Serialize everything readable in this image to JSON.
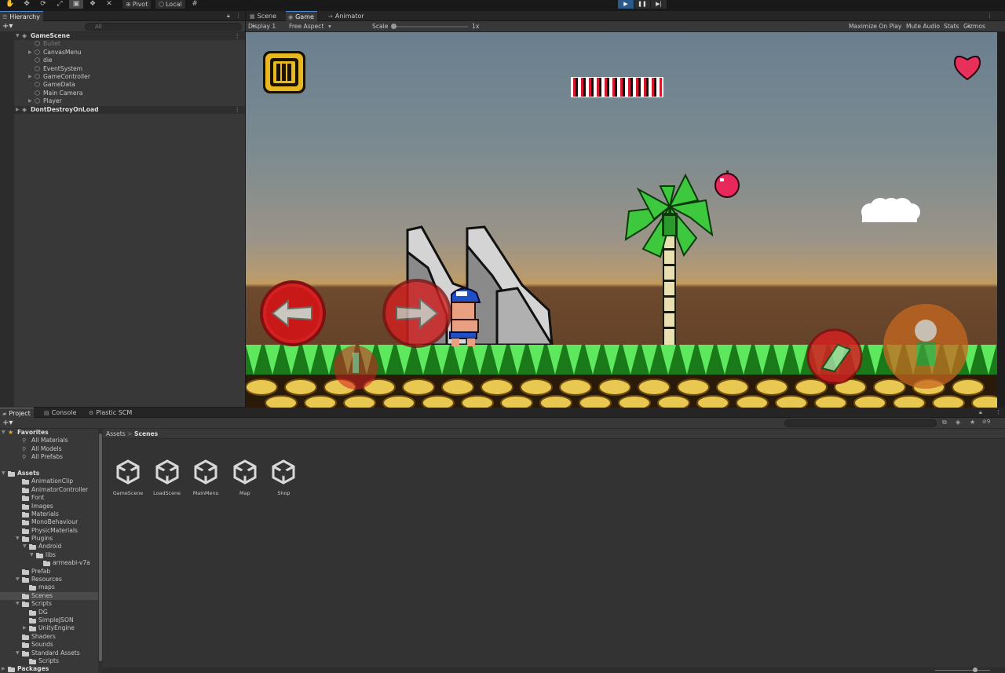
{
  "toolbar": {
    "pivot_label": "Pivot",
    "local_label": "Local"
  },
  "hierarchy": {
    "tab_label": "Hierarchy",
    "search_placeholder": "All",
    "items": [
      {
        "label": "GameScene",
        "type": "scene"
      },
      {
        "label": "Bullet",
        "type": "disabled"
      },
      {
        "label": "CanvasMenu"
      },
      {
        "label": "die"
      },
      {
        "label": "EventSystem"
      },
      {
        "label": "GameController"
      },
      {
        "label": "GameData"
      },
      {
        "label": "Main Camera"
      },
      {
        "label": "Player"
      },
      {
        "label": "DontDestroyOnLoad",
        "type": "scene"
      }
    ]
  },
  "game_tabs": {
    "scene": "Scene",
    "game": "Game",
    "animator": "Animator"
  },
  "game_bar": {
    "display": "Display 1",
    "aspect": "Free Aspect",
    "scale_label": "Scale",
    "scale_value": "1x",
    "maximize": "Maximize On Play",
    "mute": "Mute Audio",
    "stats": "Stats",
    "gizmos": "Gizmos"
  },
  "project_tabs": {
    "project": "Project",
    "console": "Console",
    "plastic": "Plastic SCM"
  },
  "project": {
    "badge_count": "9",
    "breadcrumb_root": "Assets",
    "breadcrumb_sep": ">",
    "breadcrumb_current": "Scenes",
    "tree": [
      {
        "label": "Favorites",
        "kind": "favorites"
      },
      {
        "label": "All Materials",
        "kind": "search"
      },
      {
        "label": "All Models",
        "kind": "search"
      },
      {
        "label": "All Prefabs",
        "kind": "search"
      },
      {
        "label": "",
        "kind": "spacer"
      },
      {
        "label": "Assets",
        "kind": "header"
      },
      {
        "label": "AnimationClip"
      },
      {
        "label": "AnimatorController"
      },
      {
        "label": "Font"
      },
      {
        "label": "Images"
      },
      {
        "label": "Materials"
      },
      {
        "label": "MonoBehaviour"
      },
      {
        "label": "PhysicMaterials"
      },
      {
        "label": "Plugins"
      },
      {
        "label": "Android"
      },
      {
        "label": "libs"
      },
      {
        "label": "armeabi-v7a"
      },
      {
        "label": "Prefab"
      },
      {
        "label": "Resources"
      },
      {
        "label": "maps"
      },
      {
        "label": "Scenes",
        "kind": "selected"
      },
      {
        "label": "Scripts"
      },
      {
        "label": "DG"
      },
      {
        "label": "SimpleJSON"
      },
      {
        "label": "UnityEngine"
      },
      {
        "label": "Shaders"
      },
      {
        "label": "Sounds"
      },
      {
        "label": "Standard Assets"
      },
      {
        "label": "Scripts"
      },
      {
        "label": "Packages",
        "kind": "header"
      }
    ],
    "assets": [
      "GameScene",
      "LoadScene",
      "MainMenu",
      "Map",
      "Shop"
    ]
  },
  "colors": {
    "accent": "#4a8ad6",
    "panel": "#383838",
    "play_active": "#2a5a8a"
  }
}
